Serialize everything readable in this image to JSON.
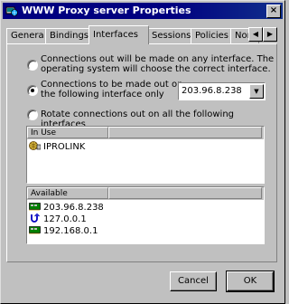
{
  "window": {
    "title": "WWW Proxy server Properties",
    "close_glyph": "×"
  },
  "tabs": [
    {
      "label": "Genera",
      "active": false
    },
    {
      "label": "Bindings",
      "active": false
    },
    {
      "label": "Interfaces",
      "active": true
    },
    {
      "label": "Sessions",
      "active": false
    },
    {
      "label": "Policies",
      "active": false
    },
    {
      "label": "Nor",
      "active": false
    }
  ],
  "tab_scroll": {
    "left_glyph": "◀",
    "right_glyph": "▶"
  },
  "options": {
    "any_interface": {
      "checked": false,
      "line1": "Connections out will be made on any interface. The",
      "line2": "operating system will choose the correct interface."
    },
    "specific_interface": {
      "checked": true,
      "line1": "Connections to be made out on",
      "line2": "the following interface only",
      "selected_interface": "203.96.8.238",
      "dropdown_glyph": "▼"
    },
    "rotate": {
      "checked": false,
      "label": "Rotate connections out on all the following interfaces"
    }
  },
  "in_use_list": {
    "header": "In Use",
    "items": [
      {
        "label": "IPROLINK",
        "icon": "globe-icon"
      }
    ]
  },
  "available_list": {
    "header": "Available",
    "items": [
      {
        "label": "203.96.8.238",
        "icon": "network-card-icon"
      },
      {
        "label": "127.0.0.1",
        "icon": "loopback-icon"
      },
      {
        "label": "192.168.0.1",
        "icon": "network-card-icon"
      }
    ]
  },
  "buttons": {
    "cancel": "Cancel",
    "ok": "OK"
  },
  "colors": {
    "titlebar": "#000080",
    "face": "#c0c0c0"
  }
}
